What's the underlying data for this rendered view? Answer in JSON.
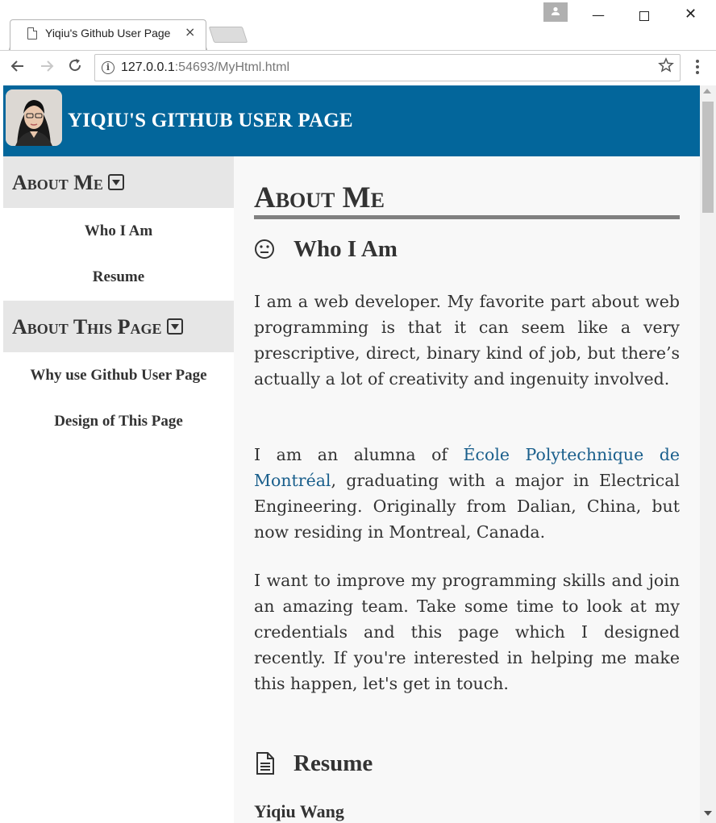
{
  "browser": {
    "tab_title": "Yiqiu's Github User Page",
    "tab_close": "×",
    "url_host": "127.0.0.1",
    "url_rest": ":54693/MyHtml.html",
    "window_min": "—",
    "window_close": "✕"
  },
  "site": {
    "title": "YIQIU'S GITHUB USER PAGE"
  },
  "sidebar": {
    "sections": [
      {
        "label": "About Me",
        "items": [
          "Who I Am",
          "Resume"
        ]
      },
      {
        "label": "About This Page",
        "items": [
          "Why use Github User Page",
          "Design of This Page"
        ]
      }
    ]
  },
  "main": {
    "section_title": "About Me",
    "who_title": "Who I Am",
    "para1": "I am a web developer. My favorite part about web programming is that it can seem like a very prescriptive, direct, binary kind of job, but there’s actually a lot of creativity and ingenuity involved.",
    "para2_before": "I am an alumna of ",
    "para2_link": "École Polytechnique de Montréal",
    "para2_after": ", graduating with a major in Electrical Engineering. Originally from Dalian, China, but now residing in Montreal, Canada.",
    "para3": "I want to improve my programming skills and join an amazing team. Take some time to look at my credentials and this page which I designed recently. If you're interested in helping me make this happen, let's get in touch.",
    "resume_title": "Resume",
    "author_name": "Yiqiu Wang"
  },
  "colors": {
    "header_bg": "#03669b",
    "sidebar_head_bg": "#e6e6e6",
    "link": "#1a5f8c",
    "rule": "#808080"
  },
  "icons": [
    "page-icon",
    "back-arrow-icon",
    "forward-arrow-icon",
    "reload-icon",
    "info-icon",
    "star-icon",
    "menu-icon",
    "caret-down-icon",
    "neutral-face-icon",
    "document-icon",
    "user-icon"
  ]
}
